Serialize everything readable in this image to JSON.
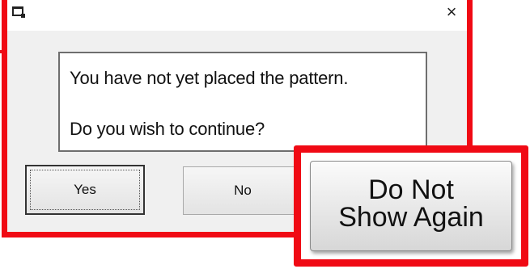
{
  "dialog": {
    "title": "",
    "close_glyph": "×",
    "message_line1": "You have not yet placed the pattern.",
    "message_line2": "Do you wish to continue?",
    "buttons": {
      "yes": "Yes",
      "no": "No"
    }
  },
  "callout": {
    "button_line1": "Do Not",
    "button_line2": "Show Again"
  },
  "colors": {
    "highlight_red": "#f00a14",
    "dialog_bg": "#f0f0f0",
    "titlebar_bg": "#ffffff"
  },
  "icons": {
    "app": "window-app-icon",
    "close": "close-icon"
  }
}
